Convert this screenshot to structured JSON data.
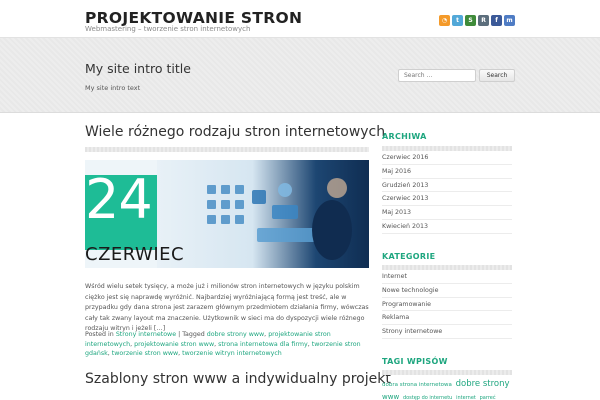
{
  "header": {
    "site_title": "PROJEKTOWANIE STRON",
    "site_description": "Webmastering – tworzenie stron internetowych",
    "social_icons": [
      {
        "icon": "rss-icon",
        "glyph": "◔",
        "color": "#f49a2a"
      },
      {
        "icon": "twitter-icon",
        "glyph": "t",
        "color": "#52a8d8"
      },
      {
        "icon": "stumbleupon-icon",
        "glyph": "S",
        "color": "#3f8b3a"
      },
      {
        "icon": "reddit-icon",
        "glyph": "R",
        "color": "#5c6e7c"
      },
      {
        "icon": "facebook-icon",
        "glyph": "f",
        "color": "#3b5998"
      },
      {
        "icon": "myspace-icon",
        "glyph": "m",
        "color": "#4f7cc4"
      }
    ]
  },
  "intro": {
    "title": "My site intro title",
    "text": "My site intro text",
    "search_placeholder": "Search ...",
    "search_button": "Search"
  },
  "post": {
    "title": "Wiele różnego rodzaju stron internetowych",
    "date_day": "24",
    "date_month": "CZERWIEC",
    "excerpt": "Wśród wielu setek tysięcy, a może już i milionów stron internetowych w języku polskim ciężko jest się naprawdę wyróżnić. Najbardziej wyróżniającą formą jest treść, ale w przypadku gdy dana strona jest zarazem głównym przedmiotem działania firmy, wówczas cały tak zwany layout ma znaczenie. Użytkownik w sieci ma do dyspozycji wiele różnego rodzaju witryn i jeżeli […]",
    "posted_in_label": "Posted in",
    "category": "Strony internetowe",
    "tagged_label": "| Tagged",
    "tags": [
      "dobre strony www",
      "projektowanie stron internetowych",
      "projektowanie stron www",
      "strona internetowa dla firmy",
      "tworzenie stron gdańsk",
      "tworzenie stron www",
      "tworzenie witryn internetowych"
    ]
  },
  "post2": {
    "title": "Szablony stron www a indywidualny projekt"
  },
  "sidebar": {
    "archive_title": "ARCHIWA",
    "archive_items": [
      "Czerwiec 2016",
      "Maj 2016",
      "Grudzień 2013",
      "Czerwiec 2013",
      "Maj 2013",
      "Kwiecień 2013"
    ],
    "categories_title": "KATEGORIE",
    "category_items": [
      "Internet",
      "Nowe technologie",
      "Programowanie",
      "Reklama",
      "Strony internetowe"
    ],
    "tags_title": "TAGI WPISÓW",
    "tag_cloud": [
      {
        "label": "dobra strona internetowa",
        "size": "5.5px"
      },
      {
        "label": "dobre strony",
        "size": "8.5px"
      },
      {
        "label": "www",
        "size": "7px"
      },
      {
        "label": "dostęp do internetu",
        "size": "5px"
      },
      {
        "label": "internet",
        "size": "5px"
      },
      {
        "label": "parreć",
        "size": "5px"
      }
    ]
  },
  "colors": {
    "accent": "#1ea67f",
    "date_block": "#1ebc96"
  }
}
